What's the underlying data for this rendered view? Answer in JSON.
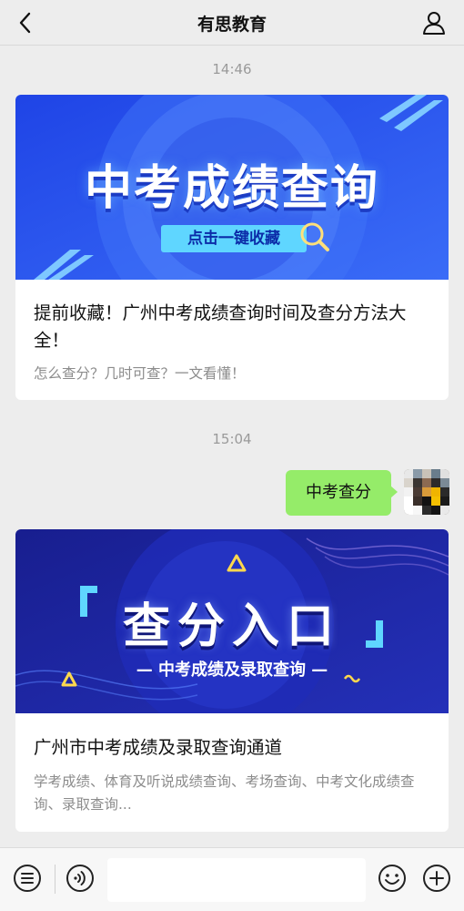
{
  "header": {
    "title": "有思教育",
    "back_icon": "chevron-left-icon",
    "profile_icon": "person-icon"
  },
  "messages": [
    {
      "time": "14:46",
      "type": "article",
      "banner_title": "中考成绩查询",
      "banner_button": "点击一键收藏",
      "title": "提前收藏！广州中考成绩查询时间及查分方法大全！",
      "description": "怎么查分？几时可查？一文看懂！"
    },
    {
      "time": "15:04",
      "type": "text",
      "text": "中考查分",
      "sender": "me"
    },
    {
      "type": "article",
      "banner_title": "查分入口",
      "banner_subtitle": "— 中考成绩及录取查询 —",
      "title": "广州市中考成绩及录取查询通道",
      "description": "学考成绩、体育及听说成绩查询、考场查询、中考文化成绩查询、录取查询..."
    }
  ],
  "bottombar": {
    "menu_icon": "list-icon",
    "voice_icon": "voice-icon",
    "emoji_icon": "emoji-icon",
    "plus_icon": "plus-icon",
    "input_value": ""
  },
  "colors": {
    "background": "#ededed",
    "bubble": "#95ec69",
    "banner1_blue": "#2b54f0",
    "banner2_navy": "#1a1f9e"
  }
}
